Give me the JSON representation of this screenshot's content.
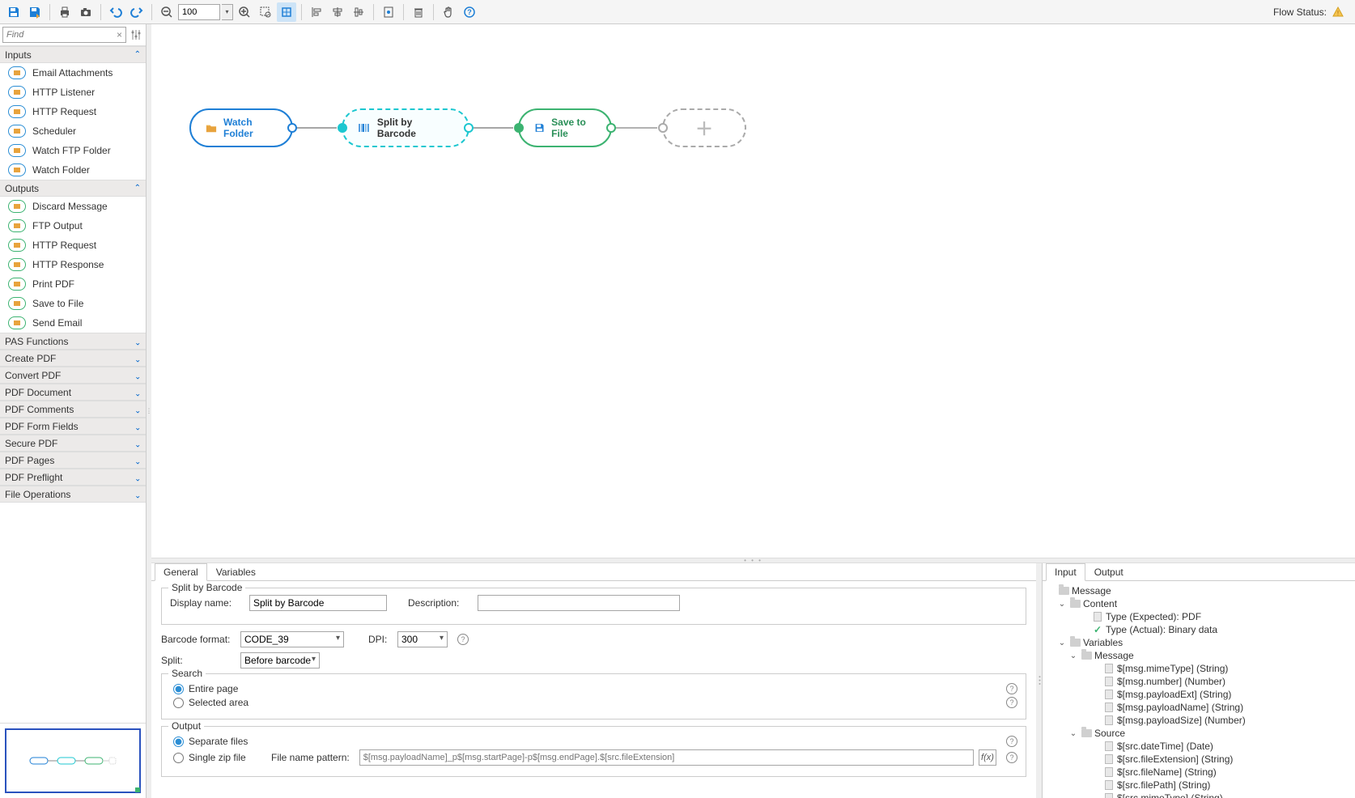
{
  "toolbar": {
    "zoom": "100",
    "flow_status_label": "Flow Status:"
  },
  "find": {
    "placeholder": "Find"
  },
  "categories": {
    "inputs": {
      "title": "Inputs",
      "items": [
        "Email Attachments",
        "HTTP Listener",
        "HTTP Request",
        "Scheduler",
        "Watch FTP Folder",
        "Watch Folder"
      ]
    },
    "outputs": {
      "title": "Outputs",
      "items": [
        "Discard Message",
        "FTP Output",
        "HTTP Request",
        "HTTP Response",
        "Print PDF",
        "Save to File",
        "Send Email"
      ]
    },
    "collapsed": [
      "PAS Functions",
      "Create PDF",
      "Convert PDF",
      "PDF Document",
      "PDF Comments",
      "PDF Form Fields",
      "Secure PDF",
      "PDF Pages",
      "PDF Preflight",
      "File Operations"
    ]
  },
  "canvas": {
    "nodes": {
      "watch": "Watch Folder",
      "split": "Split by Barcode",
      "save": "Save to File"
    }
  },
  "props": {
    "tabs": {
      "general": "General",
      "variables": "Variables"
    },
    "legend": "Split by Barcode",
    "display_label": "Display name:",
    "display_value": "Split by Barcode",
    "desc_label": "Description:",
    "desc_value": "",
    "barcode_label": "Barcode format:",
    "barcode_value": "CODE_39",
    "dpi_label": "DPI:",
    "dpi_value": "300",
    "split_label": "Split:",
    "split_value": "Before barcode",
    "search_legend": "Search",
    "search_entire": "Entire page",
    "search_area": "Selected area",
    "output_legend": "Output",
    "output_sep": "Separate files",
    "output_zip": "Single zip file",
    "fnp_label": "File name pattern:",
    "fnp_placeholder": "$[msg.payloadName]_p$[msg.startPage]-p$[msg.endPage].$[src.fileExtension]"
  },
  "right": {
    "tabs": {
      "input": "Input",
      "output": "Output"
    },
    "tree": {
      "message": "Message",
      "content": "Content",
      "type_expected": "Type (Expected): PDF",
      "type_actual": "Type (Actual): Binary data",
      "variables": "Variables",
      "msg_node": "Message",
      "msg_items": [
        "$[msg.mimeType] (String)",
        "$[msg.number] (Number)",
        "$[msg.payloadExt] (String)",
        "$[msg.payloadName] (String)",
        "$[msg.payloadSize] (Number)"
      ],
      "source": "Source",
      "src_items": [
        "$[src.dateTime] (Date)",
        "$[src.fileExtension] (String)",
        "$[src.fileName] (String)",
        "$[src.filePath] (String)",
        "$[src.mimeType] (String)"
      ]
    }
  }
}
